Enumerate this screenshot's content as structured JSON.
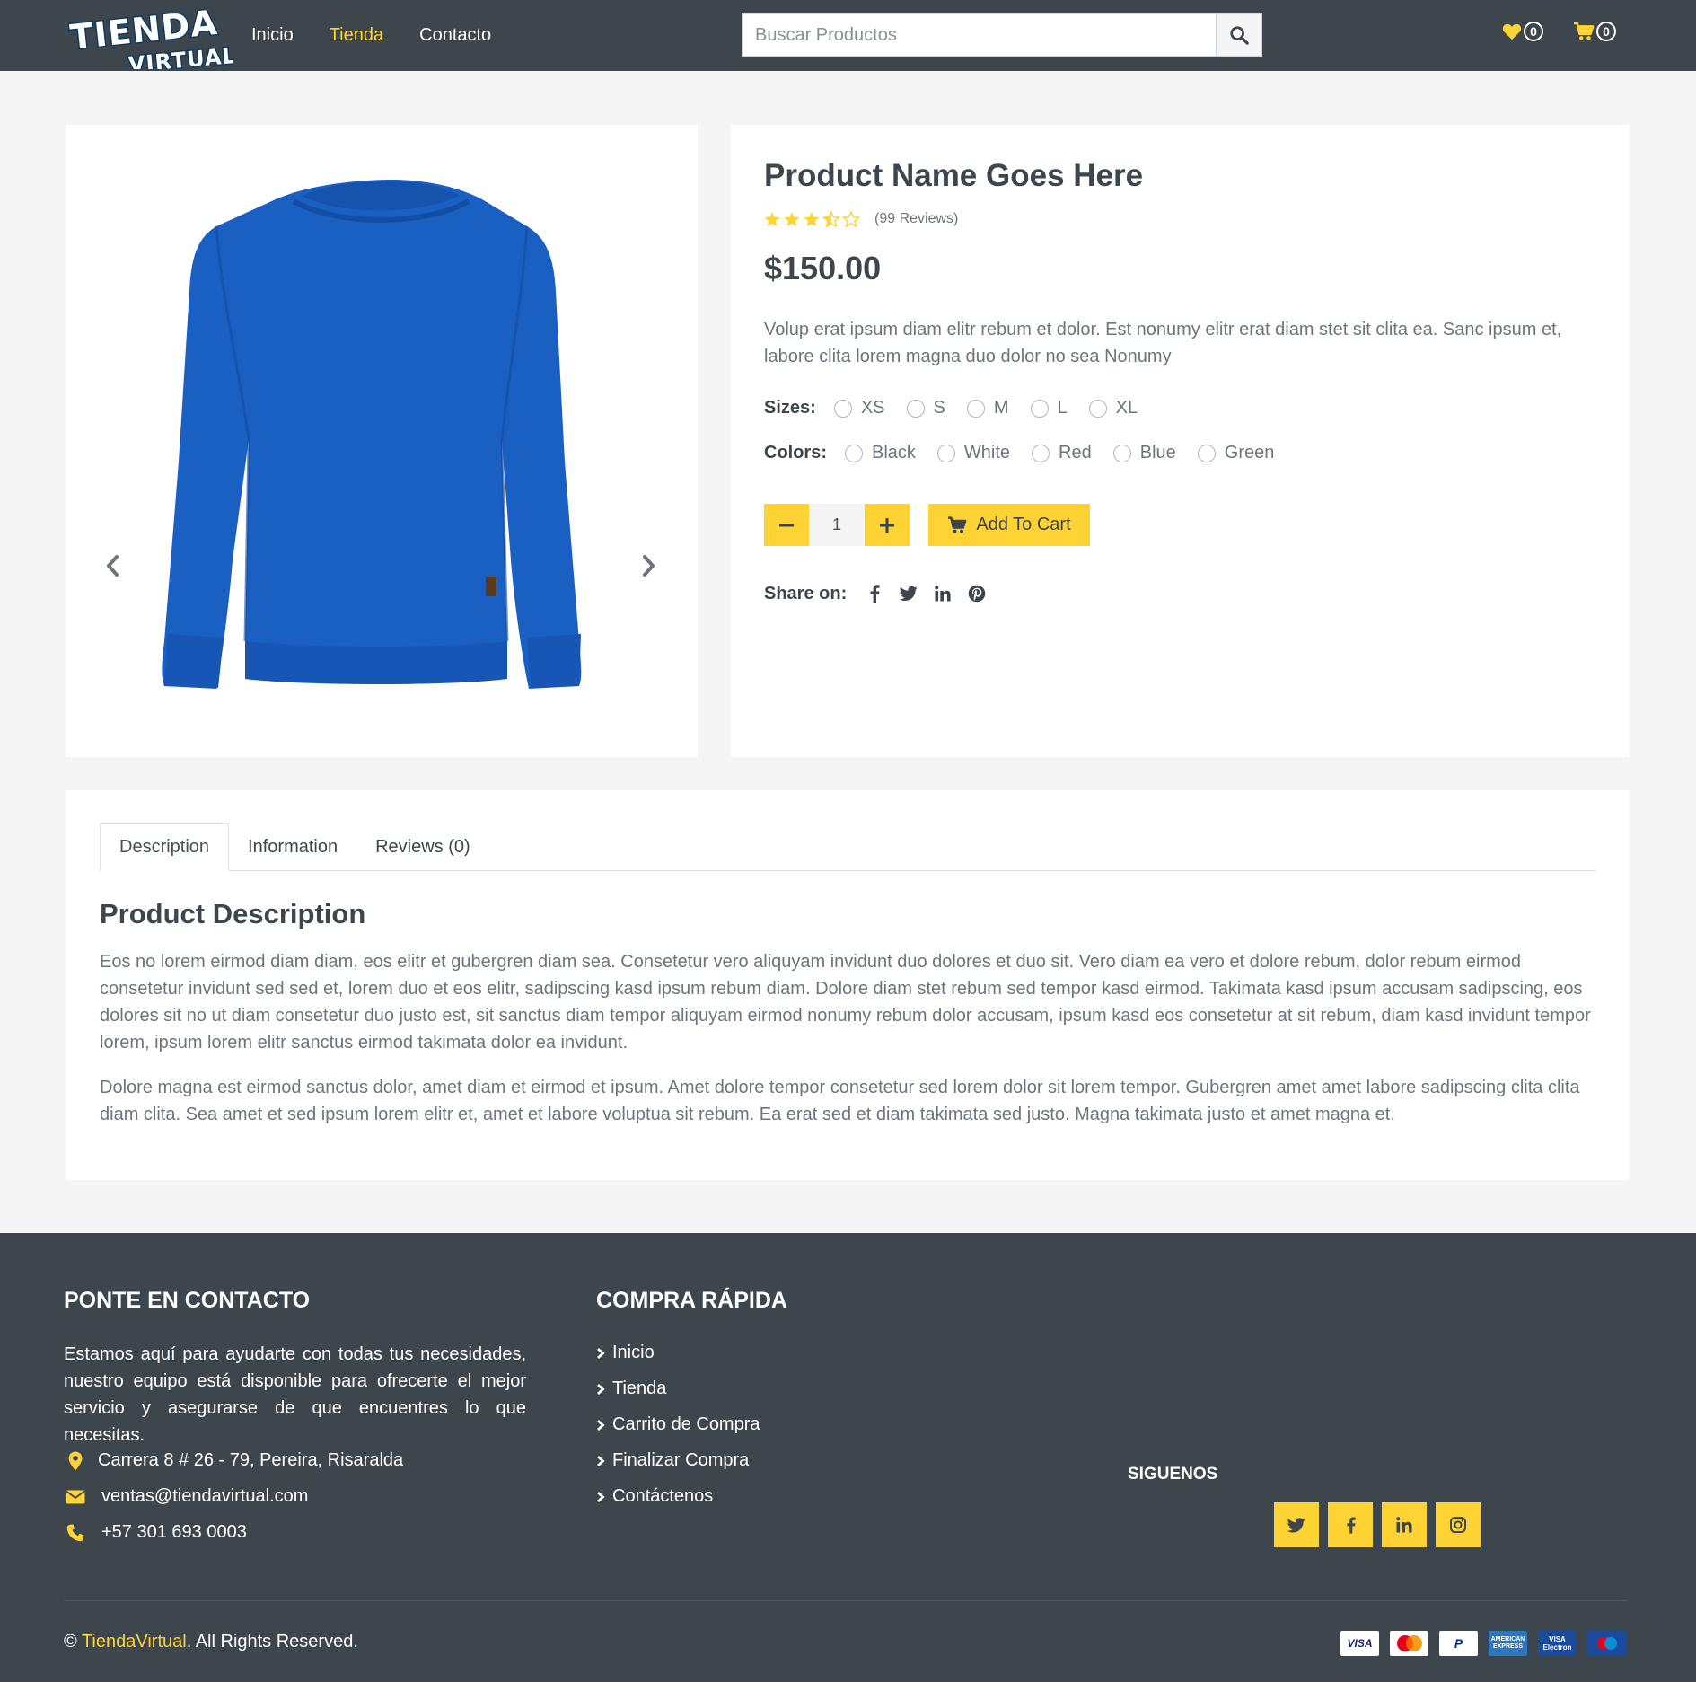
{
  "header": {
    "logo_line1": "TIENDA",
    "logo_line2": "VIRTUAL",
    "nav": [
      {
        "label": "Inicio"
      },
      {
        "label": "Tienda"
      },
      {
        "label": "Contacto"
      }
    ],
    "active_nav": "Tienda",
    "search_placeholder": "Buscar Productos",
    "wishlist_count": "0",
    "cart_count": "0"
  },
  "product": {
    "name": "Product Name Goes Here",
    "rating": 3.5,
    "rating_max": 5,
    "reviews_text": "(99 Reviews)",
    "price": "$150.00",
    "description": "Volup erat ipsum diam elitr rebum et dolor. Est nonumy elitr erat diam stet sit clita ea. Sanc ipsum et, labore clita lorem magna duo dolor no sea Nonumy",
    "sizes_label": "Sizes:",
    "sizes": [
      "XS",
      "S",
      "M",
      "L",
      "XL"
    ],
    "colors_label": "Colors:",
    "colors": [
      "Black",
      "White",
      "Red",
      "Blue",
      "Green"
    ],
    "quantity": "1",
    "add_to_cart": "Add To Cart",
    "share_label": "Share on:",
    "image_color": "#1a5fc2"
  },
  "tabs": [
    {
      "label": "Description"
    },
    {
      "label": "Information"
    },
    {
      "label": "Reviews (0)"
    }
  ],
  "description": {
    "title": "Product Description",
    "paragraph1": "Eos no lorem eirmod diam diam, eos elitr et gubergren diam sea. Consetetur vero aliquyam invidunt duo dolores et duo sit. Vero diam ea vero et dolore rebum, dolor rebum eirmod consetetur invidunt sed sed et, lorem duo et eos elitr, sadipscing kasd ipsum rebum diam. Dolore diam stet rebum sed tempor kasd eirmod. Takimata kasd ipsum accusam sadipscing, eos dolores sit no ut diam consetetur duo justo est, sit sanctus diam tempor aliquyam eirmod nonumy rebum dolor accusam, ipsum kasd eos consetetur at sit rebum, diam kasd invidunt tempor lorem, ipsum lorem elitr sanctus eirmod takimata dolor ea invidunt.",
    "paragraph2": "Dolore magna est eirmod sanctus dolor, amet diam et eirmod et ipsum. Amet dolore tempor consetetur sed lorem dolor sit lorem tempor. Gubergren amet amet labore sadipscing clita clita diam clita. Sea amet et sed ipsum lorem elitr et, amet et labore voluptua sit rebum. Ea erat sed et diam takimata sed justo. Magna takimata justo et amet magna et."
  },
  "footer": {
    "contact_title": "PONTE EN CONTACTO",
    "contact_text": "Estamos aquí para ayudarte con todas tus necesidades, nuestro equipo está disponible para ofrecerte el mejor servicio y asegurarse de que encuentres lo que necesitas.",
    "address": "Carrera 8 # 26 - 79, Pereira, Risaralda",
    "email": "ventas@tiendavirtual.com",
    "phone": "+57 301 693 0003",
    "quick_title": "COMPRA RÁPIDA",
    "quick_links": [
      {
        "label": "Inicio"
      },
      {
        "label": "Tienda"
      },
      {
        "label": "Carrito de Compra"
      },
      {
        "label": "Finalizar Compra"
      },
      {
        "label": "Contáctenos"
      }
    ],
    "follow_title": "SIGUENOS",
    "copyright_prefix": "©",
    "copyright_brand": "TiendaVirtual",
    "copyright_suffix": ". All Rights Reserved.",
    "payments": [
      "VISA",
      "MasterCard",
      "PayPal",
      "American Express",
      "Visa Electron",
      "Maestro"
    ]
  },
  "colors": {
    "accent": "#ffd333",
    "dark": "#3d464d",
    "text": "#6c757d",
    "background": "#f5f5f5"
  }
}
